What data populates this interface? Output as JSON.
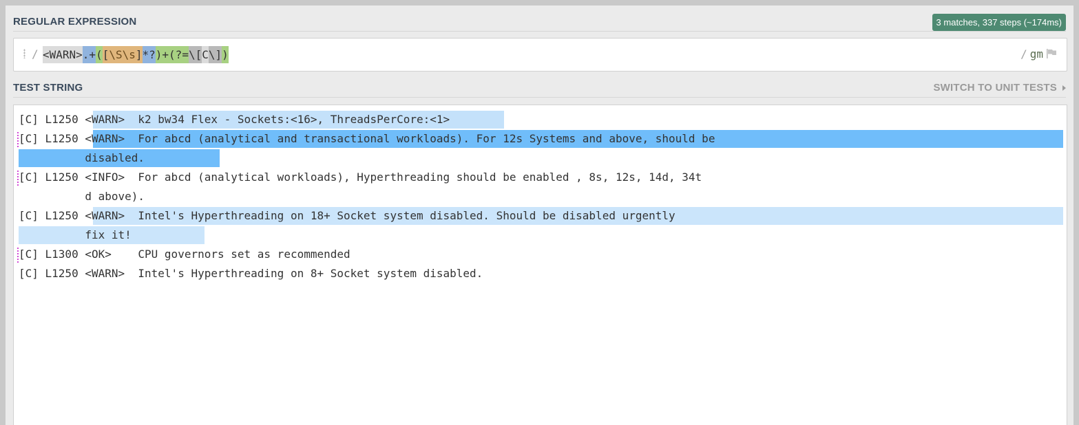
{
  "regex_section": {
    "title": "REGULAR EXPRESSION",
    "match_info": "3 matches, 337 steps (~174ms)",
    "open_delimiter": "/",
    "close_delimiter": "/",
    "flags": "gm",
    "pattern_tokens": [
      "<WARN>",
      ".+",
      "(",
      "[",
      "\\S\\s",
      "]",
      "*?",
      ")+",
      "(?=",
      "\\[",
      "C",
      "\\]",
      ")"
    ]
  },
  "test_section": {
    "title": "TEST STRING",
    "switch_label": "SWITCH TO UNIT TESTS",
    "lines": [
      {
        "prefix": "[C] L1250 ",
        "tag": "<WARN>",
        "rest": "  k2 bw34 Flex - Sockets:<16>, ThreadsPerCore:<1>"
      },
      {
        "prefix": "[C] L1250 ",
        "tag": "<WARN>",
        "rest": "  For abcd (analytical and transactional workloads). For 12s Systems and above, should be"
      },
      {
        "text": "          disabled."
      },
      {
        "text": "[C] L1250 <INFO>  For abcd (analytical workloads), Hyperthreading should be enabled , 8s, 12s, 14d, 34t"
      },
      {
        "text": "          d above)."
      },
      {
        "prefix": "[C] L1250 ",
        "tag": "<WARN>",
        "rest": "  Intel's Hyperthreading on 18+ Socket system disabled. Should be disabled urgently"
      },
      {
        "text": "          fix it!"
      },
      {
        "text": "[C] L1300 <OK>    CPU governors set as recommended"
      },
      {
        "text": "[C] L1250 <WARN>  Intel's Hyperthreading on 8+ Socket system disabled."
      }
    ]
  },
  "colors": {
    "match_light": "#c4e1fa",
    "match_strong": "#70bdfa",
    "badge": "#4e8a72"
  }
}
